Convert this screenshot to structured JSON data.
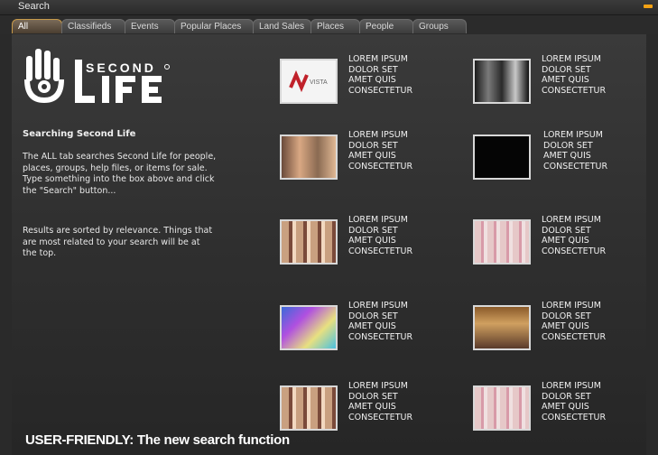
{
  "window": {
    "title": "Search"
  },
  "tabs": [
    {
      "label": "All",
      "active": true
    },
    {
      "label": "Classifieds",
      "active": false
    },
    {
      "label": "Events",
      "active": false
    },
    {
      "label": "Popular Places",
      "active": false
    },
    {
      "label": "Land Sales",
      "active": false
    },
    {
      "label": "Places",
      "active": false
    },
    {
      "label": "People",
      "active": false
    },
    {
      "label": "Groups",
      "active": false
    }
  ],
  "logo": {
    "brand": "SECOND LIFE"
  },
  "info": {
    "heading": "Searching Second Life",
    "description": "The ALL tab searches Second Life for people, places, groups, help files, or items for sale. Type something into the box above and click the \"Search\" button...",
    "description2": "Results are sorted by relevance. Things that are most related to your search will be at the top."
  },
  "results": [
    {
      "text": "LOREM IPSUM\nDOLOR SET\nAMET QUIS\nCONSECTETUR",
      "thumb": "vista-logo"
    },
    {
      "text": "LOREM IPSUM\nDOLOR SET\nAMET QUIS\nCONSECTETUR",
      "thumb": "portrait-photo"
    },
    {
      "text": "LOREM IPSUM\nDOLOR SET\nAMET QUIS\nCONSECTETUR",
      "thumb": "face-photo"
    },
    {
      "text": "LOREM IPSUM\nDOLOR SET\nAMET QUIS\nCONSECTETUR",
      "thumb": "black-image"
    },
    {
      "text": "LOREM IPSUM\nDOLOR SET\nAMET QUIS\nCONSECTETUR",
      "thumb": "product-grid"
    },
    {
      "text": "LOREM IPSUM\nDOLOR SET\nAMET QUIS\nCONSECTETUR",
      "thumb": "group-photo"
    },
    {
      "text": "LOREM IPSUM\nDOLOR SET\nAMET QUIS\nCONSECTETUR",
      "thumb": "colorful-poster"
    },
    {
      "text": "LOREM IPSUM\nDOLOR SET\nAMET QUIS\nCONSECTETUR",
      "thumb": "store-scene"
    },
    {
      "text": "LOREM IPSUM\nDOLOR SET\nAMET QUIS\nCONSECTETUR",
      "thumb": "product-grid"
    },
    {
      "text": "LOREM IPSUM\nDOLOR SET\nAMET QUIS\nCONSECTETUR",
      "thumb": "group-photo"
    }
  ],
  "caption": "USER-FRIENDLY: The new search function",
  "colors": {
    "accent": "#f2a114",
    "active_tab_border": "#c79a4a",
    "background": "#2a2a2a"
  }
}
